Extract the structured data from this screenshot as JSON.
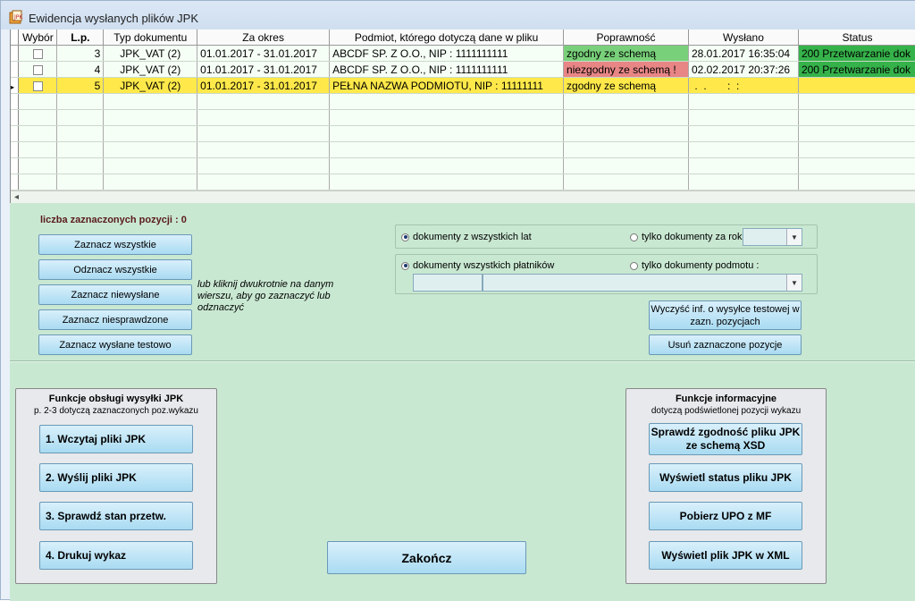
{
  "window": {
    "title": "Ewidencja wysłanych plików JPK"
  },
  "grid": {
    "headers": [
      "Wybór",
      "L.p.",
      "Typ dokumentu",
      "Za okres",
      "Podmiot, którego dotyczą dane w pliku",
      "Poprawność",
      "Wysłano",
      "Status"
    ],
    "rows": [
      {
        "lp": "3",
        "typ": "JPK_VAT (2)",
        "okres": "01.01.2017 - 31.01.2017",
        "podmiot": "ABCDF SP. Z O.O.,  NIP : 1111111111",
        "poprawnosc": "zgodny ze schemą",
        "wyslano": "28.01.2017 16:35:04",
        "status": "200 Przetwarzanie dok"
      },
      {
        "lp": "4",
        "typ": "JPK_VAT (2)",
        "okres": "01.01.2017 - 31.01.2017",
        "podmiot": "ABCDF SP. Z O.O.,  NIP : 1111111111",
        "poprawnosc": "niezgodny ze schemą !",
        "wyslano": "02.02.2017 20:37:26",
        "status": "200 Przetwarzanie dok"
      },
      {
        "lp": "5",
        "typ": "JPK_VAT (2)",
        "okres": "01.01.2017 - 31.01.2017",
        "podmiot": "PEŁNA NAZWA PODMIOTU,  NIP : 11111111",
        "poprawnosc": "zgodny ze schemą",
        "wyslano": " .  .       :  :",
        "status": ""
      }
    ],
    "scroll_left_glyph": "◂",
    "row_pointer_glyph": "▸"
  },
  "selection": {
    "count_label": "liczba zaznaczonych pozycji : 0",
    "buttons": [
      "Zaznacz wszystkie",
      "Odznacz wszystkie",
      "Zaznacz niewysłane",
      "Zaznacz niesprawdzone",
      "Zaznacz wysłane testowo"
    ],
    "hint": "lub kliknij dwukrotnie na danym wierszu, aby go zaznaczyć lub odznaczyć"
  },
  "filters": {
    "year_all": "dokumenty z wszystkich lat",
    "year_only": "tylko dokumenty za rok :",
    "payer_all": "dokumenty wszystkich płatników",
    "payer_only": "tylko dokumenty podmotu :"
  },
  "actions": {
    "clear_test": "Wyczyść inf. o wysyłce testowej w zazn. pozycjach",
    "remove_selected": "Usuń zaznaczone pozycje"
  },
  "send_functions": {
    "title": "Funkcje obsługi wysyłki JPK",
    "subtitle": "p. 2-3 dotyczą zaznaczonych poz.wykazu",
    "buttons": [
      "1. Wczytaj pliki JPK",
      "2. Wyślij pliki JPK",
      "3. Sprawdź stan przetw.",
      "4. Drukuj wykaz"
    ]
  },
  "close_button": "Zakończ",
  "info_functions": {
    "title": "Funkcje informacyjne",
    "subtitle": "dotyczą podświetlonej pozycji wykazu",
    "buttons": [
      "Sprawdź zgodność pliku JPK ze schemą XSD",
      "Wyświetl status pliku JPK",
      "Pobierz UPO z MF",
      "Wyświetl plik JPK w XML"
    ]
  },
  "colors": {
    "ok": "#79d07a",
    "bad": "#e88585",
    "status_ok": "#35b24a",
    "active_row": "#ffe94a",
    "panel": "#c9e8d2"
  }
}
